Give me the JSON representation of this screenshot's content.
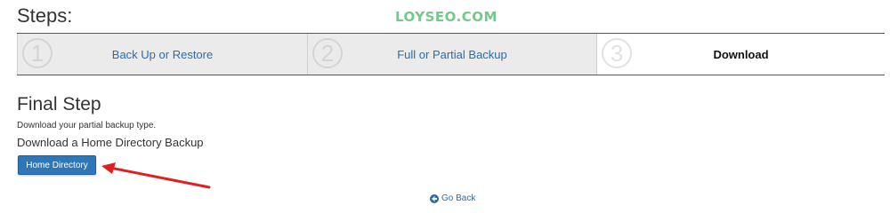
{
  "header": {
    "title": "Steps:",
    "watermark": "LOYSEO.COM"
  },
  "stepper": {
    "steps": [
      {
        "number": "1",
        "label": "Back Up or Restore",
        "state": "done"
      },
      {
        "number": "2",
        "label": "Full or Partial Backup",
        "state": "done"
      },
      {
        "number": "3",
        "label": "Download",
        "state": "current"
      }
    ]
  },
  "main": {
    "title": "Final Step",
    "description": "Download your partial backup type.",
    "subtitle": "Download a Home Directory Backup",
    "home_button_label": "Home Directory",
    "go_back_label": "Go Back"
  },
  "icons": {
    "go_back": "circle-arrow-left-icon",
    "annotation": "red-arrow-icon"
  },
  "colors": {
    "link": "#2a6cae",
    "button": "#2f76b8",
    "arrow": "#e02020",
    "watermark": "#74c88a"
  }
}
